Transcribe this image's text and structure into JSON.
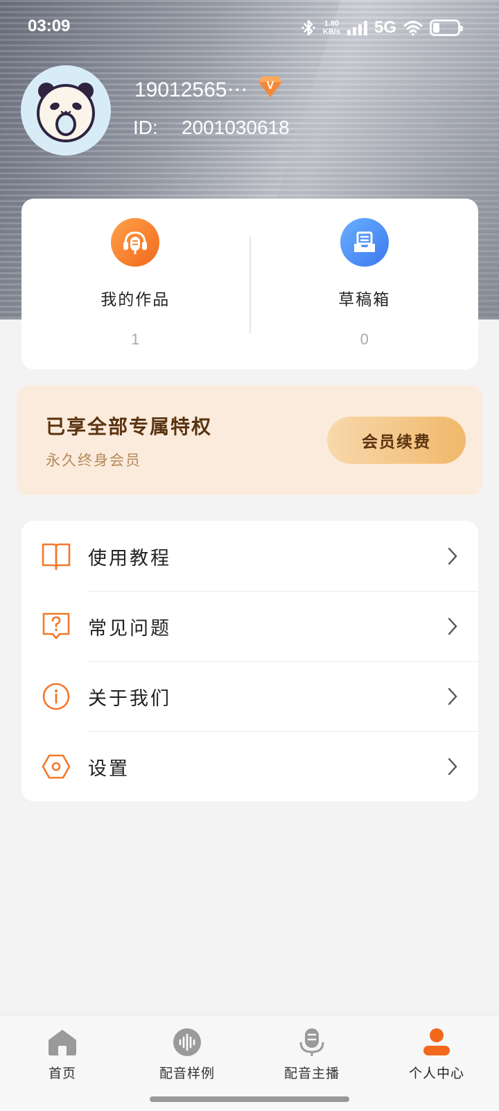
{
  "status_bar": {
    "time": "03:09",
    "speed_value": "1.80",
    "speed_unit": "KB/s",
    "network": "5G",
    "battery_level": 0.25
  },
  "profile": {
    "username": "19012565⋯",
    "vip_badge_letter": "V",
    "id_label": "ID:",
    "id_value": "2001030618"
  },
  "stats": [
    {
      "label": "我的作品",
      "count": "1"
    },
    {
      "label": "草稿箱",
      "count": "0"
    }
  ],
  "membership": {
    "title": "已享全部专属特权",
    "subtitle": "永久终身会员",
    "renew_label": "会员续费"
  },
  "menu": [
    {
      "label": "使用教程",
      "icon": "book-icon"
    },
    {
      "label": "常见问题",
      "icon": "question-bubble-icon"
    },
    {
      "label": "关于我们",
      "icon": "info-icon"
    },
    {
      "label": "设置",
      "icon": "settings-hexagon-icon"
    }
  ],
  "tabs": [
    {
      "label": "首页",
      "icon": "home-icon"
    },
    {
      "label": "配音样例",
      "icon": "audio-wave-icon"
    },
    {
      "label": "配音主播",
      "icon": "microphone-icon"
    },
    {
      "label": "个人中心",
      "icon": "person-icon"
    }
  ],
  "colors": {
    "accent_orange": "#f2681c",
    "accent_blue": "#3c78ee",
    "vip_card_bg": "#fbebdd",
    "vip_text": "#5a3310"
  }
}
